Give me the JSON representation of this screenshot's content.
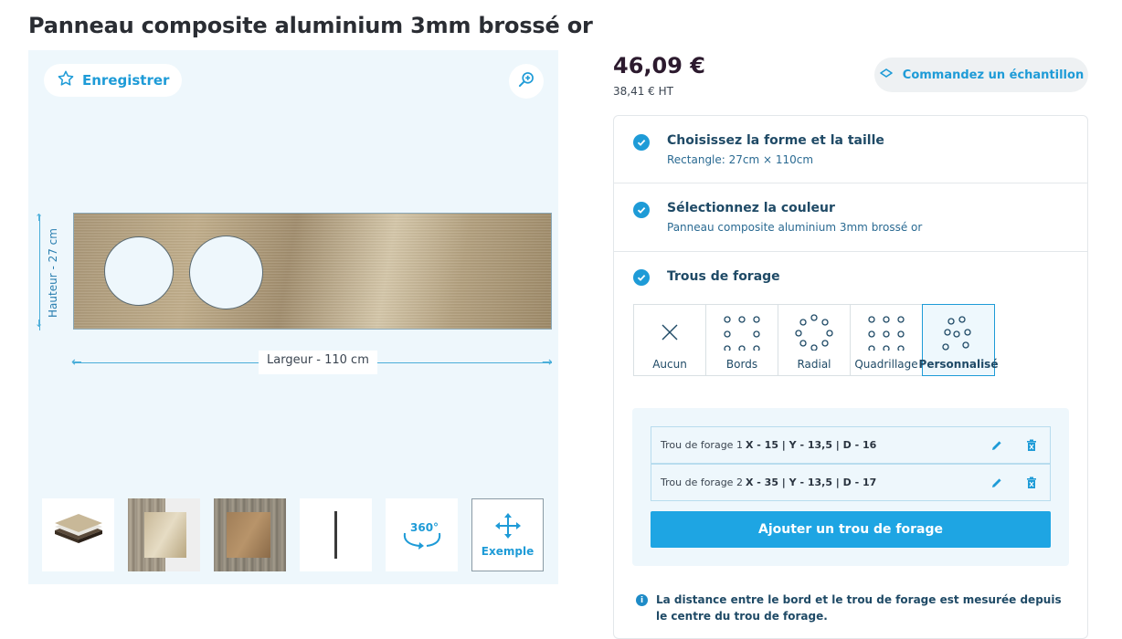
{
  "product": {
    "title": "Panneau composite aluminium 3mm brossé or"
  },
  "viewer": {
    "save_label": "Enregistrer",
    "height_label": "Hauteur - 27 cm",
    "width_label": "Largeur - 110 cm",
    "thumbnails": [
      {
        "name": "layers"
      },
      {
        "name": "brushed-gold-on-wood"
      },
      {
        "name": "bronze-on-wood"
      },
      {
        "name": "edge-profile"
      },
      {
        "name": "rotate-360",
        "label": "360°"
      },
      {
        "name": "example",
        "label": "Exemple"
      }
    ]
  },
  "pricing": {
    "price": "46,09 €",
    "price_ht": "38,41 € HT",
    "sample_label": "Commandez un échantillon"
  },
  "steps": [
    {
      "title": "Choisissez la forme et la taille",
      "subtitle": "Rectangle: 27cm × 110cm"
    },
    {
      "title": "Sélectionnez la couleur",
      "subtitle": "Panneau composite aluminium 3mm brossé or"
    },
    {
      "title": "Trous de forage"
    }
  ],
  "hole_options": [
    {
      "label": "Aucun",
      "icon": "x-icon"
    },
    {
      "label": "Bords",
      "icon": "edges-icon"
    },
    {
      "label": "Radial",
      "icon": "radial-icon"
    },
    {
      "label": "Quadrillage",
      "icon": "grid-icon"
    },
    {
      "label": "Personnalisé",
      "icon": "custom-icon",
      "selected": true
    }
  ],
  "holes": [
    {
      "prefix": "Trou de forage 1",
      "values": "X - 15 | Y - 13,5 | D - 16"
    },
    {
      "prefix": "Trou de forage 2",
      "values": "X - 35 | Y - 13,5 | D - 17"
    }
  ],
  "add_hole_label": "Ajouter un trou de forage",
  "note": "La distance entre le bord et le trou de forage est mesurée depuis le centre du trou de forage.",
  "colors": {
    "accent": "#1e9bd7",
    "button": "#1ea5e3",
    "viewer_bg": "#eef7fc"
  }
}
